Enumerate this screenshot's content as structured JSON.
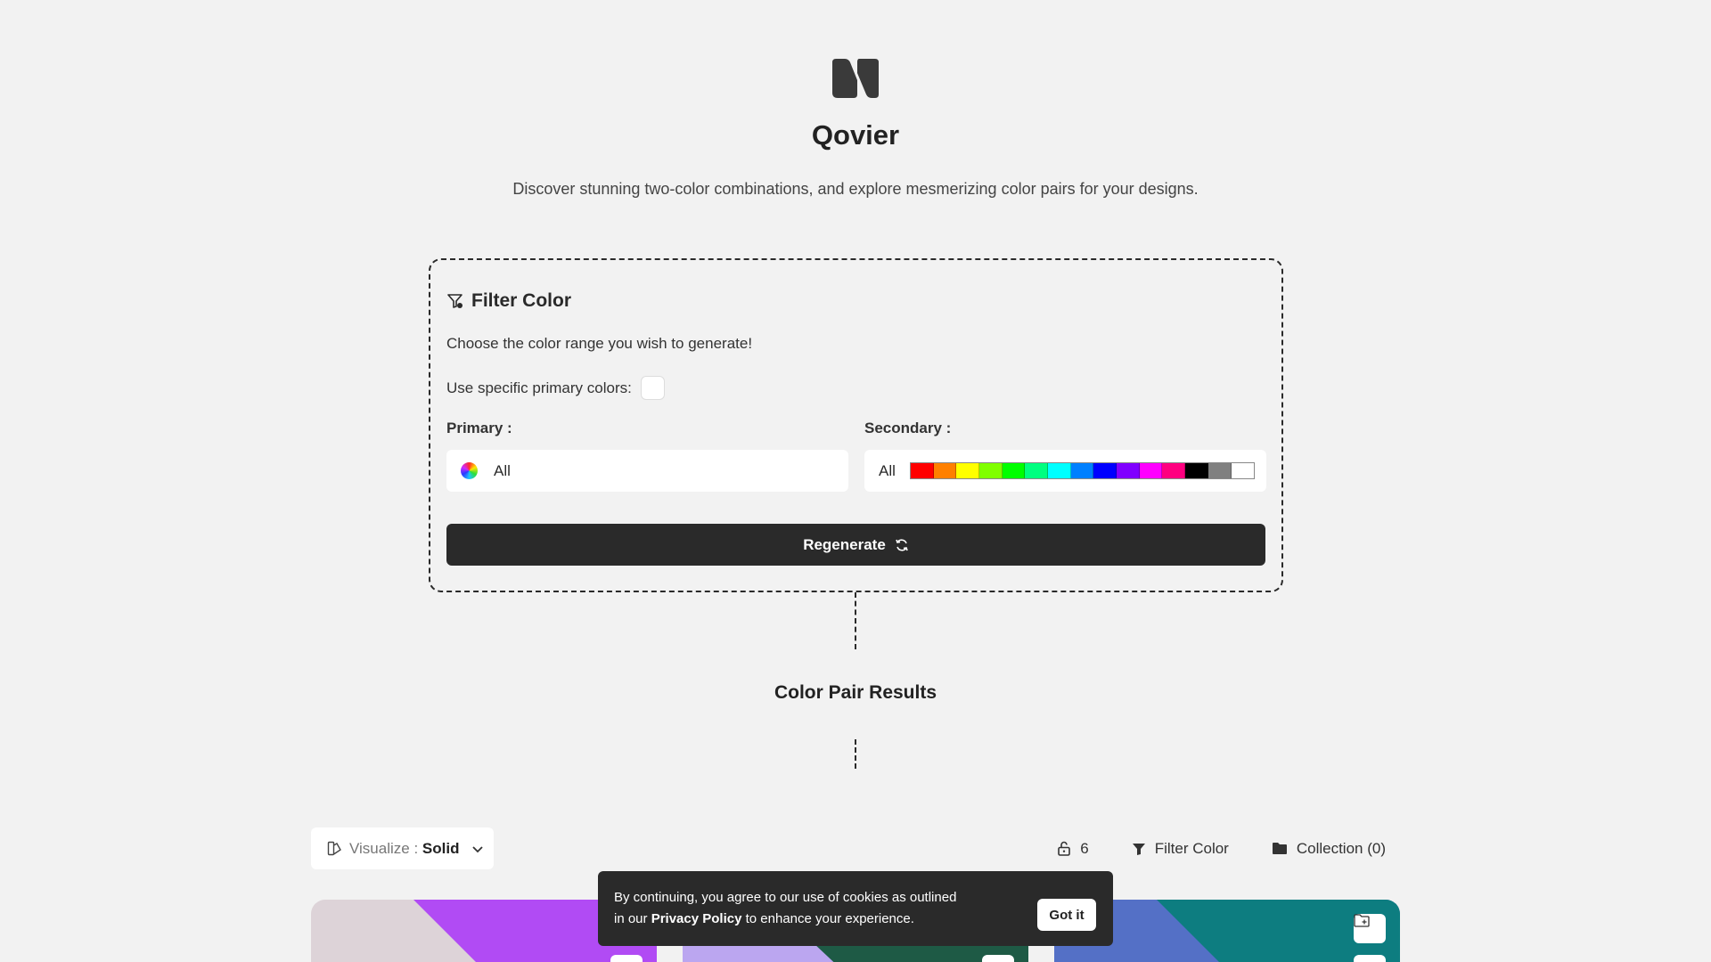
{
  "header": {
    "logo_icon": "qovier-logo-icon",
    "title": "Qovier",
    "tagline": "Discover stunning two-color combinations, and explore mesmerizing color pairs for your designs."
  },
  "filter": {
    "title": "Filter Color",
    "icon": "filter-settings-icon",
    "subtitle": "Choose the color range you wish to generate!",
    "specific_label": "Use specific primary colors:",
    "specific_checked": false,
    "primary_label": "Primary :",
    "primary_value": "All",
    "secondary_label": "Secondary :",
    "secondary_value": "All",
    "secondary_swatches": [
      "#ff0000",
      "#ff8000",
      "#ffff00",
      "#80ff00",
      "#00ff00",
      "#00ff80",
      "#00ffff",
      "#0080ff",
      "#0000ff",
      "#8000ff",
      "#ff00ff",
      "#ff0080",
      "#000000",
      "#808080",
      "#ffffff"
    ],
    "regenerate_label": "Regenerate",
    "regenerate_icon": "refresh-icon"
  },
  "results": {
    "title": "Color Pair Results",
    "visualize_label": "Visualize :",
    "visualize_value": "Solid",
    "lock_count": "6",
    "filter_color_label": "Filter Color",
    "collection_label": "Collection (0)"
  },
  "cards": [
    {
      "color_a": "#ddd3d8",
      "color_b": "#b14bf4"
    },
    {
      "color_a": "#bba6f0",
      "color_b": "#1e5a45"
    },
    {
      "color_a": "#5470c6",
      "color_b": "#0d7d80"
    }
  ],
  "cookie": {
    "text_before": "By continuing, you agree to our use of cookies as outlined in our",
    "link": "Privacy Policy",
    "text_after": "to enhance your experience.",
    "button": "Got it"
  }
}
